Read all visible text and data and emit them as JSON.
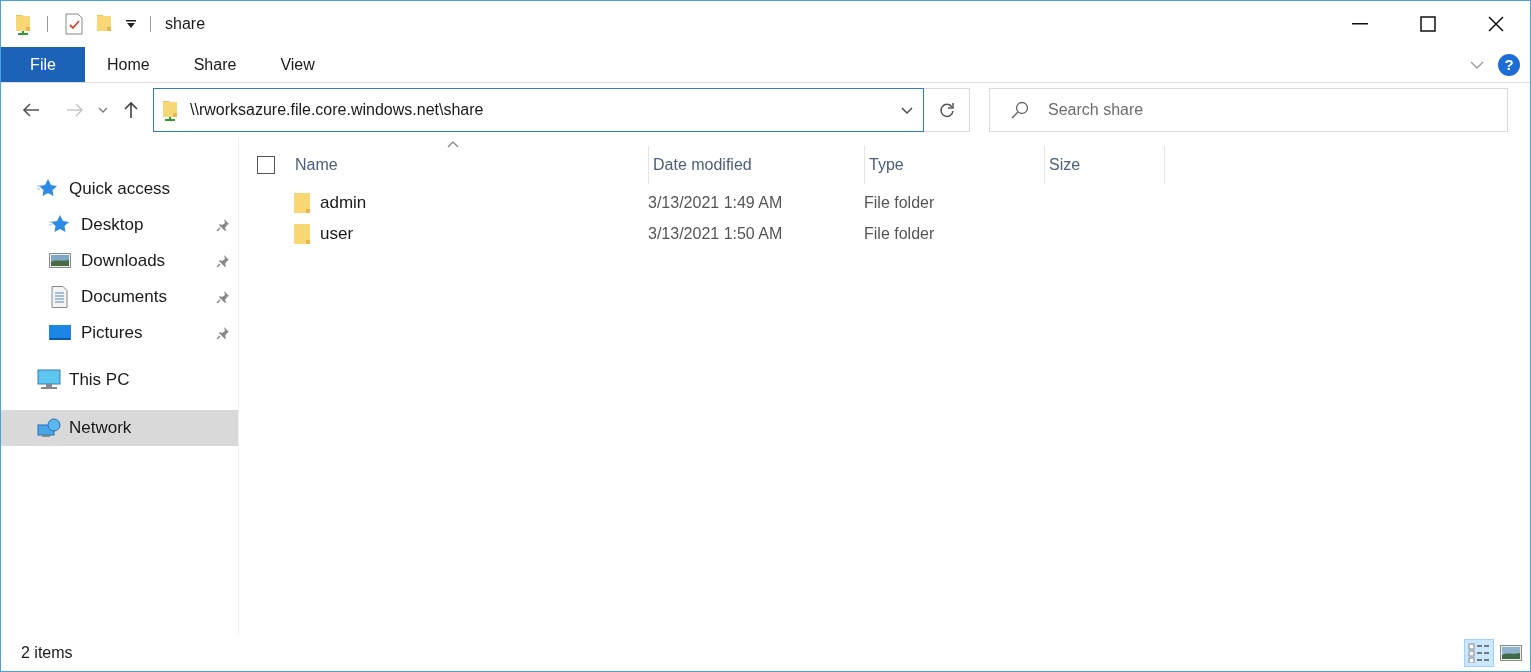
{
  "window": {
    "title": "share"
  },
  "ribbon": {
    "tabs": [
      {
        "label": "File",
        "kind": "file",
        "selected": false
      },
      {
        "label": "Home",
        "kind": "tab",
        "selected": false
      },
      {
        "label": "Share",
        "kind": "tab",
        "selected": false
      },
      {
        "label": "View",
        "kind": "tab",
        "selected": false
      }
    ],
    "help": "?"
  },
  "address_bar": {
    "path": "\\\\rworksazure.file.core.windows.net\\share"
  },
  "search": {
    "placeholder": "Search share"
  },
  "navigation": [
    {
      "label": "Quick access",
      "kind": "quick",
      "selected": false,
      "children": [
        {
          "label": "Desktop",
          "kind": "desktop",
          "pinned": true,
          "selected": false
        },
        {
          "label": "Downloads",
          "kind": "downloads",
          "pinned": true,
          "selected": false
        },
        {
          "label": "Documents",
          "kind": "documents",
          "pinned": true,
          "selected": false
        },
        {
          "label": "Pictures",
          "kind": "pictures",
          "pinned": true,
          "selected": false
        }
      ]
    },
    {
      "label": "This PC",
      "kind": "pc",
      "selected": false
    },
    {
      "label": "Network",
      "kind": "network",
      "selected": true
    }
  ],
  "file_list": {
    "select_all": {
      "checked": false
    },
    "columns": [
      "Name",
      "Date modified",
      "Type",
      "Size"
    ],
    "rows": [
      {
        "name": "admin",
        "date": "3/13/2021 1:49 AM",
        "type": "File folder",
        "selected": false
      },
      {
        "name": "user",
        "date": "3/13/2021 1:50 AM",
        "type": "File folder",
        "selected": false
      }
    ]
  },
  "status_bar": {
    "text": "2 items",
    "views": [
      {
        "kind": "details",
        "selected": true
      },
      {
        "kind": "thumbnails",
        "selected": false
      }
    ]
  }
}
